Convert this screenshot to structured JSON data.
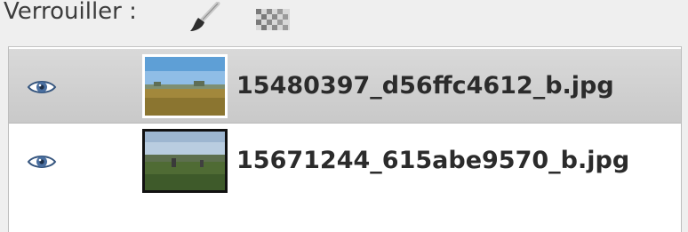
{
  "lock": {
    "label": "Verrouiller :",
    "pixels_icon": "paintbrush-icon",
    "alpha_icon": "checkerboard-icon"
  },
  "layers": [
    {
      "name": "15480397_d56ffc4612_b.jpg",
      "visible": true,
      "selected": true,
      "visibility_icon": "eye-icon"
    },
    {
      "name": "15671244_615abe9570_b.jpg",
      "visible": true,
      "selected": false,
      "visibility_icon": "eye-icon"
    }
  ],
  "colors": {
    "selected_row": "#cfcfcf",
    "list_background": "#ffffff",
    "panel_background": "#efefef",
    "eye_icon": "#4a6fa0"
  }
}
